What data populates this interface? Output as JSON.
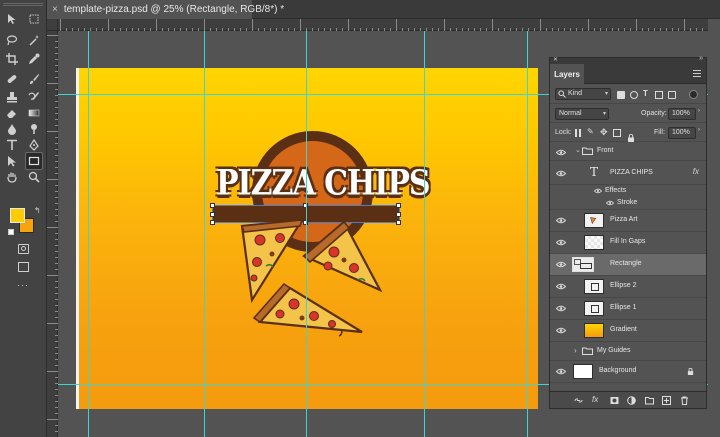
{
  "document_tab": {
    "close_glyph": "×",
    "title": "template-pizza.psd @ 25% (Rectangle, RGB/8*) *"
  },
  "toolbar": {
    "tools": [
      "move-icon",
      "artboard-icon",
      "lasso-icon",
      "magic-wand-icon",
      "crop-icon",
      "eyedropper-icon",
      "healing-brush-icon",
      "brush-icon",
      "clone-stamp-icon",
      "history-brush-icon",
      "eraser-icon",
      "gradient-icon",
      "blur-icon",
      "dodge-icon",
      "pen-icon",
      "type-icon",
      "path-selection-icon",
      "rectangle-icon",
      "hand-icon",
      "zoom-icon"
    ],
    "foreground_color": "#ffcc00",
    "background_color": "#f7a30f"
  },
  "canvas": {
    "heading": "PIZZA CHIPS",
    "gradient_top": "#ffd500",
    "gradient_bottom": "#f59b0e",
    "brand_brown": "#5b2f14",
    "brand_orange": "#d46718",
    "guide_color": "#3fd4d4"
  },
  "layers_panel": {
    "tab_label": "Layers",
    "filter_value": "Kind",
    "blend_mode": "Normal",
    "opacity_label": "Opacity:",
    "opacity_value": "100%",
    "lock_label": "Lock:",
    "fill_label": "Fill:",
    "fill_value": "100%",
    "layers": [
      {
        "name": "Front",
        "kind": "group"
      },
      {
        "name": "PIZZA CHIPS",
        "kind": "type",
        "fx": "fx"
      },
      {
        "name": "Effects",
        "kind": "effects"
      },
      {
        "name": "Stroke",
        "kind": "effect"
      },
      {
        "name": "Pizza Art",
        "kind": "image"
      },
      {
        "name": "Fill In Gaps",
        "kind": "image"
      },
      {
        "name": "Rectangle",
        "kind": "shape",
        "selected": true
      },
      {
        "name": "Ellipse 2",
        "kind": "shape"
      },
      {
        "name": "Ellipse 1",
        "kind": "shape"
      },
      {
        "name": "Gradient",
        "kind": "image"
      },
      {
        "name": "My Guides",
        "kind": "group"
      },
      {
        "name": "Background",
        "kind": "background"
      }
    ]
  }
}
